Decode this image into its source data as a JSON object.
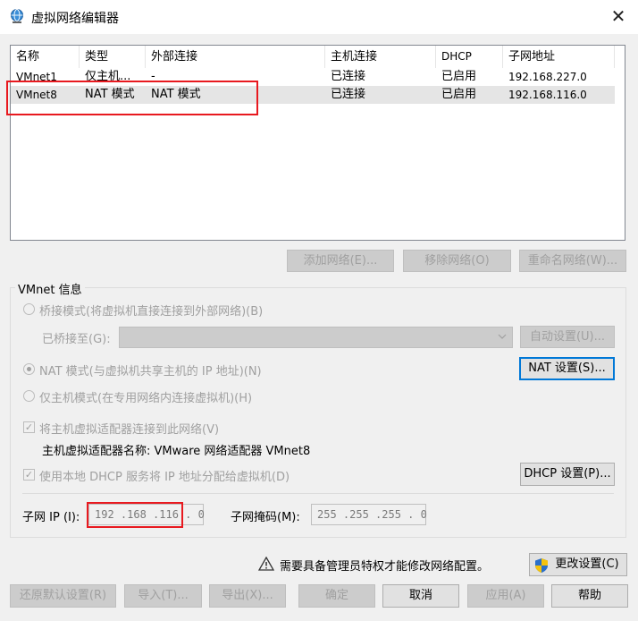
{
  "window": {
    "title": "虚拟网络编辑器",
    "close_glyph": "✕"
  },
  "list": {
    "headers": [
      "名称",
      "类型",
      "外部连接",
      "主机连接",
      "DHCP",
      "子网地址"
    ],
    "rows": [
      {
        "name": "VMnet1",
        "type": "仅主机...",
        "external": "-",
        "host": "已连接",
        "dhcp": "已启用",
        "subnet": "192.168.227.0"
      },
      {
        "name": "VMnet8",
        "type": "NAT 模式",
        "external": "NAT 模式",
        "host": "已连接",
        "dhcp": "已启用",
        "subnet": "192.168.116.0"
      }
    ],
    "selected_row": "VMnet8"
  },
  "list_buttons": {
    "add": "添加网络(E)...",
    "remove": "移除网络(O)",
    "rename": "重命名网络(W)..."
  },
  "vmnet_info": {
    "label": "VMnet 信息",
    "bridge_radio": "桥接模式(将虚拟机直接连接到外部网络)(B)",
    "bridged_to_label": "已桥接至(G):",
    "auto_settings": "自动设置(U)...",
    "nat_radio": "NAT 模式(与虚拟机共享主机的 IP 地址)(N)",
    "nat_settings": "NAT 设置(S)...",
    "hostonly_radio": "仅主机模式(在专用网络内连接虚拟机)(H)",
    "connect_adapter_check": "将主机虚拟适配器连接到此网络(V)",
    "adapter_name_text": "主机虚拟适配器名称: VMware 网络适配器 VMnet8",
    "dhcp_check": "使用本地 DHCP 服务将 IP 地址分配给虚拟机(D)",
    "dhcp_settings": "DHCP 设置(P)...",
    "subnet_ip_label": "子网 IP (I):",
    "subnet_ip_value": "192 .168 .116 . 0",
    "subnet_mask_label": "子网掩码(M):",
    "subnet_mask_value": "255 .255 .255 . 0",
    "selected_mode": "nat"
  },
  "admin_notice": "需要具备管理员特权才能修改网络配置。",
  "change_settings": "更改设置(C)",
  "footer": {
    "restore": "还原默认设置(R)",
    "import": "导入(T)...",
    "export": "导出(X)...",
    "ok": "确定",
    "cancel": "取消",
    "apply": "应用(A)",
    "help": "帮助"
  },
  "colors": {
    "highlight_red": "#e8191f",
    "focus_blue": "#0078d7",
    "disabled_text": "#a0a0a0"
  },
  "icons": [
    "globe-network-icon",
    "close-icon",
    "warning-icon",
    "uac-shield-icon",
    "chevron-down-icon"
  ]
}
